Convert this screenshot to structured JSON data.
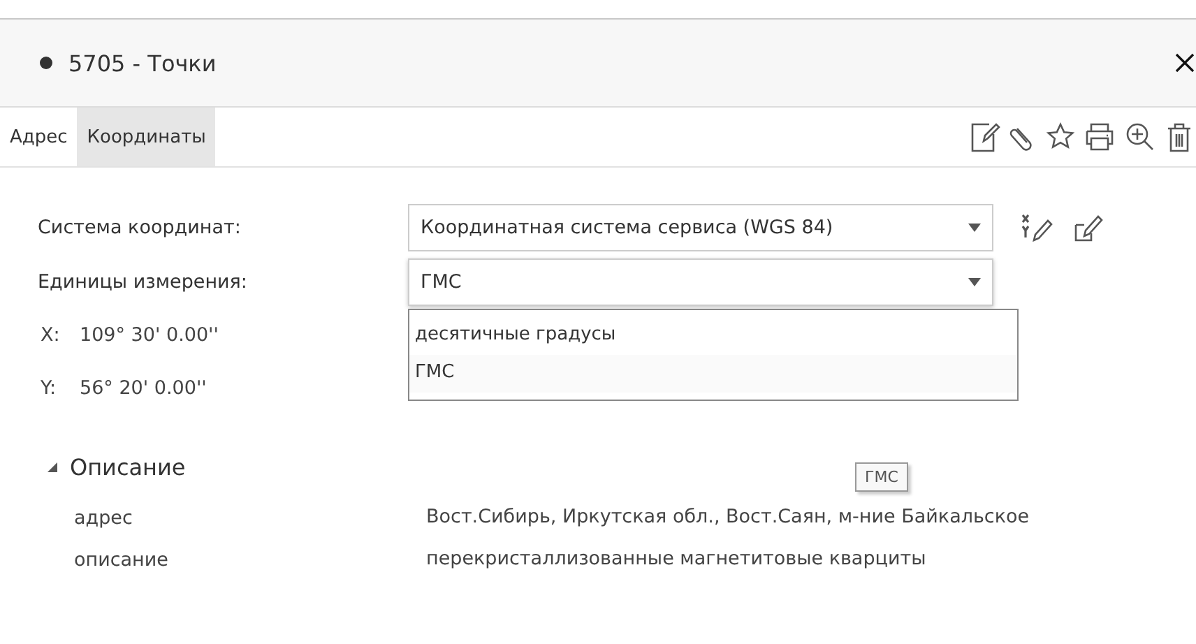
{
  "header": {
    "title": "5705 - Точки"
  },
  "tabs": [
    {
      "label": "Адрес",
      "selected": false
    },
    {
      "label": "Координаты",
      "selected": true
    }
  ],
  "form": {
    "coordinate_system": {
      "label": "Система координат:",
      "value": "Координатная система сервиса (WGS 84)"
    },
    "units": {
      "label": "Единицы измерения:",
      "value": "ГМС",
      "expanded": true,
      "options": [
        {
          "label": "десятичные градусы",
          "selected": false
        },
        {
          "label": "ГМС",
          "selected": true
        }
      ]
    }
  },
  "coordinates": [
    {
      "axis": "X:",
      "value": "109° 30' 0.00''"
    },
    {
      "axis": "Y:",
      "value": "56° 20' 0.00''"
    }
  ],
  "tooltip": "ГМС",
  "section": {
    "title": "Описание",
    "expanded": true,
    "rows": [
      {
        "key": "адрес",
        "value": "Вост.Сибирь, Иркутская обл., Вост.Саян, м-ние Байкальское"
      },
      {
        "key": "описание",
        "value": "перекристаллизованные магнетитовые кварциты"
      }
    ]
  }
}
